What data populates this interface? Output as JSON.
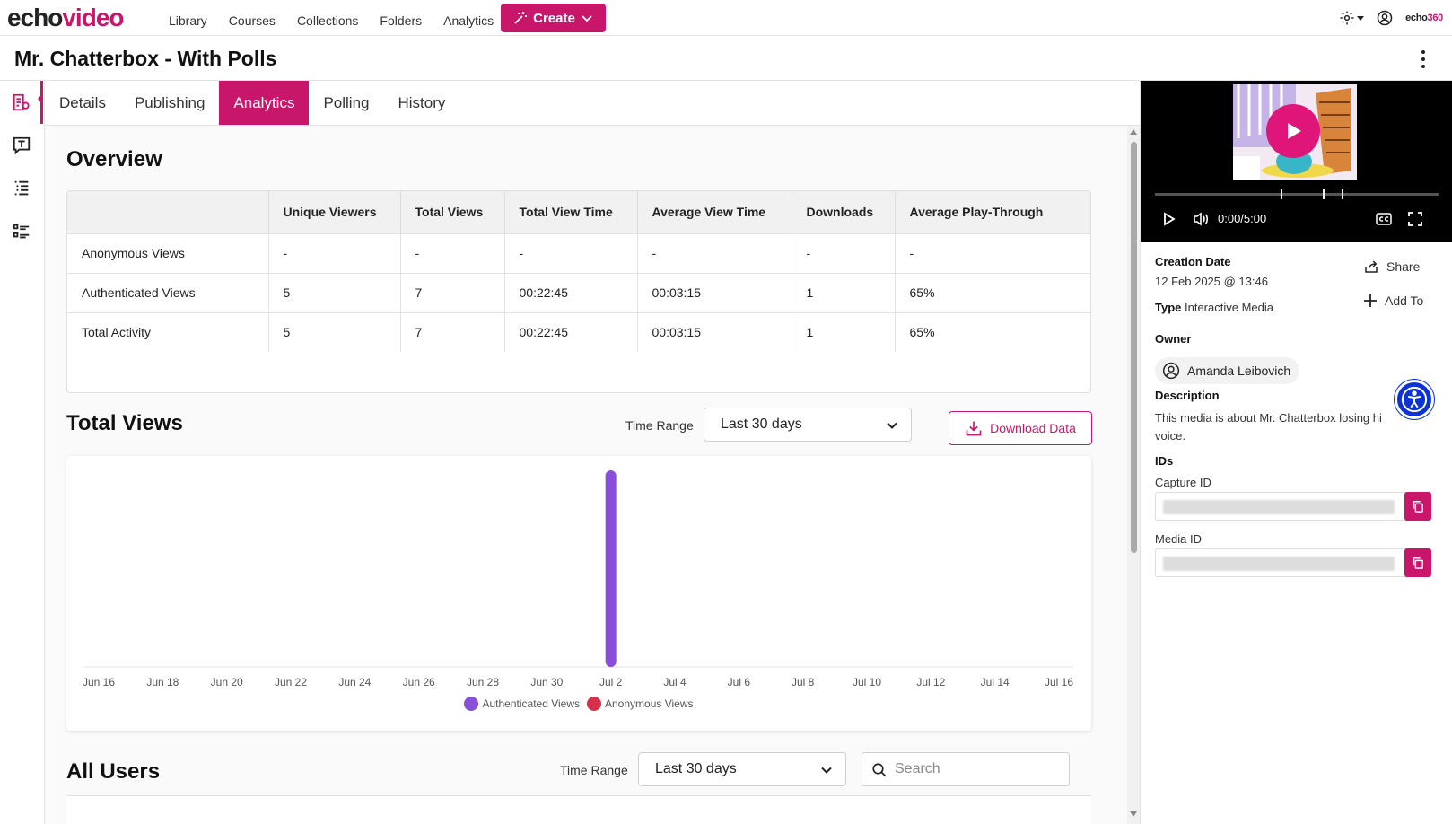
{
  "brand": {
    "logo_part1": "echo",
    "logo_part2": "video",
    "mini_part1": "echo",
    "mini_part2": "360"
  },
  "nav": {
    "items": [
      "Library",
      "Courses",
      "Collections",
      "Folders",
      "Analytics"
    ],
    "create_label": "Create"
  },
  "page": {
    "title": "Mr. Chatterbox - With Polls"
  },
  "tabs": [
    {
      "label": "Details",
      "active": false
    },
    {
      "label": "Publishing",
      "active": false
    },
    {
      "label": "Analytics",
      "active": true
    },
    {
      "label": "Polling",
      "active": false
    },
    {
      "label": "History",
      "active": false
    }
  ],
  "overview": {
    "heading": "Overview",
    "columns": [
      "",
      "Unique Viewers",
      "Total Views",
      "Total View Time",
      "Average View Time",
      "Downloads",
      "Average Play-Through"
    ],
    "rows": [
      [
        "Anonymous Views",
        "-",
        "-",
        "-",
        "-",
        "-",
        "-"
      ],
      [
        "Authenticated Views",
        "5",
        "7",
        "00:22:45",
        "00:03:15",
        "1",
        "65%"
      ],
      [
        "Total Activity",
        "5",
        "7",
        "00:22:45",
        "00:03:15",
        "1",
        "65%"
      ]
    ]
  },
  "total_views": {
    "heading": "Total Views",
    "time_range_label": "Time Range",
    "time_range_value": "Last 30 days",
    "download_label": "Download Data"
  },
  "chart_data": {
    "type": "bar",
    "x": [
      "Jun 16",
      "Jun 17",
      "Jun 18",
      "Jun 19",
      "Jun 20",
      "Jun 21",
      "Jun 22",
      "Jun 23",
      "Jun 24",
      "Jun 25",
      "Jun 26",
      "Jun 27",
      "Jun 28",
      "Jun 29",
      "Jun 30",
      "Jul 1",
      "Jul 2",
      "Jul 3",
      "Jul 4",
      "Jul 5",
      "Jul 6",
      "Jul 7",
      "Jul 8",
      "Jul 9",
      "Jul 10",
      "Jul 11",
      "Jul 12",
      "Jul 13",
      "Jul 14",
      "Jul 15",
      "Jul 16"
    ],
    "tick_labels": [
      "Jun 16",
      "Jun 18",
      "Jun 20",
      "Jun 22",
      "Jun 24",
      "Jun 26",
      "Jun 28",
      "Jun 30",
      "Jul 2",
      "Jul 4",
      "Jul 6",
      "Jul 8",
      "Jul 10",
      "Jul 12",
      "Jul 14",
      "Jul 16"
    ],
    "series": [
      {
        "name": "Authenticated Views",
        "color": "#8a4fd8",
        "values": [
          0,
          0,
          0,
          0,
          0,
          0,
          0,
          0,
          0,
          0,
          0,
          0,
          0,
          0,
          0,
          0,
          7,
          0,
          0,
          0,
          0,
          0,
          0,
          0,
          0,
          0,
          0,
          0,
          0,
          0,
          0
        ]
      },
      {
        "name": "Anonymous Views",
        "color": "#d6304a",
        "values": [
          0,
          0,
          0,
          0,
          0,
          0,
          0,
          0,
          0,
          0,
          0,
          0,
          0,
          0,
          0,
          0,
          0,
          0,
          0,
          0,
          0,
          0,
          0,
          0,
          0,
          0,
          0,
          0,
          0,
          0,
          0
        ]
      }
    ],
    "ylim": [
      0,
      7
    ],
    "grid": false,
    "legend": "bottom-center"
  },
  "all_users": {
    "heading": "All Users",
    "time_range_label": "Time Range",
    "time_range_value": "Last 30 days",
    "search_placeholder": "Search"
  },
  "player": {
    "time": "0:00/5:00"
  },
  "details": {
    "creation_date_label": "Creation Date",
    "creation_date_value": "12 Feb 2025 @ 13:46",
    "type_label": "Type",
    "type_value": "Interactive Media",
    "share_label": "Share",
    "add_to_label": "Add To",
    "owner_label": "Owner",
    "owner_name": "Amanda Leibovich",
    "description_label": "Description",
    "description_line1": "This media is about Mr. Chatterbox losing hi",
    "description_line2": "voice.",
    "ids_label": "IDs",
    "capture_id_label": "Capture ID",
    "media_id_label": "Media ID"
  },
  "colors": {
    "accent": "#c8166b",
    "authenticated": "#8a4fd8",
    "anonymous": "#d6304a",
    "a11y": "#0d33d4"
  }
}
